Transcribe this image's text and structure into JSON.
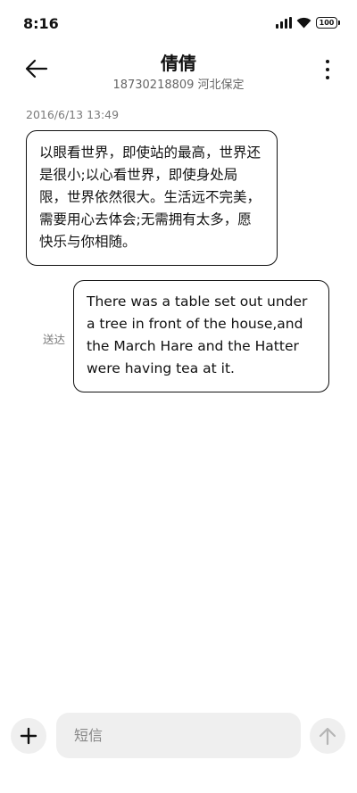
{
  "status_bar": {
    "time": "8:16",
    "battery": "100",
    "icons": [
      "signal-icon",
      "wifi-icon",
      "battery-icon"
    ]
  },
  "header": {
    "contact_name": "倩倩",
    "contact_subtitle": "18730218809 河北保定",
    "back_icon": "back-arrow-icon",
    "more_icon": "more-vertical-icon"
  },
  "conversation": {
    "timestamp": "2016/6/13 13:49",
    "messages": [
      {
        "direction": "incoming",
        "text": "以眼看世界，即使站的最高，世界还是很小;以心看世界，即使身处局限，世界依然很大。生活远不完美，需要用心去体会;无需拥有太多，愿快乐与你相随。"
      },
      {
        "direction": "outgoing",
        "text": "There was a table set out under a tree in front of the house,and the March Hare and the Hatter were having tea at it.",
        "status": "送达"
      }
    ]
  },
  "composer": {
    "placeholder": "短信",
    "value": "",
    "add_icon": "plus-icon",
    "send_icon": "send-arrow-up-icon"
  },
  "colors": {
    "background": "#ffffff",
    "text": "#111111",
    "secondary_text": "#7a7a7a",
    "input_background": "#efefef"
  }
}
